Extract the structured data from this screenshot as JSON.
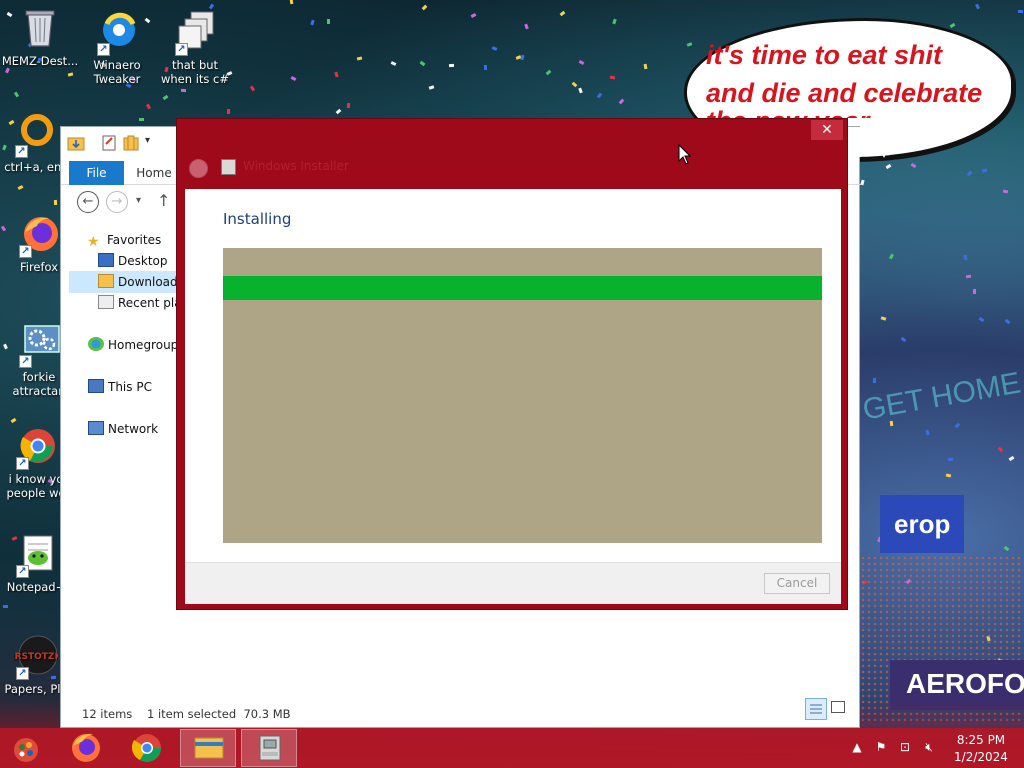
{
  "desktop": {
    "wallpaper_caption": [
      "it's time to eat shit",
      "and die and celebrate",
      "the new year"
    ],
    "icons": [
      {
        "label": "MEMZ-Dest...",
        "icon": "recycle-bin-icon"
      },
      {
        "label": "Winaero Tweaker",
        "icon": "winaero-tweaker-icon"
      },
      {
        "label": "that but when its c#",
        "icon": "windows-stack-icon"
      },
      {
        "label": "ctrl+a, ent",
        "icon": "orange-ring-icon"
      },
      {
        "label": "Firefox",
        "icon": "firefox-icon"
      },
      {
        "label": "forkie attractan",
        "icon": "settings-monitor-icon"
      },
      {
        "label": "i know yo people we",
        "icon": "chrome-icon"
      },
      {
        "label": "Notepad+",
        "icon": "notepad-plus-icon"
      },
      {
        "label": "Papers, Ple",
        "icon": "papers-please-icon"
      }
    ]
  },
  "explorer": {
    "ribbon_tabs": {
      "file": "File",
      "home": "Home"
    },
    "tree": {
      "favorites": "Favorites",
      "desktop": "Desktop",
      "downloads": "Downloads",
      "recent": "Recent plac",
      "homegroup": "Homegroup",
      "this_pc": "This PC",
      "network": "Network"
    },
    "status": {
      "items": "12 items",
      "selected": "1 item selected  70.3 MB"
    }
  },
  "installer": {
    "title": "Windows Installer",
    "heading": "Installing",
    "progress_fraction": 1.0,
    "cancel_label": "Cancel",
    "close_glyph": "✕",
    "colors": {
      "frame": "#9e0a1a",
      "progress_track": "#ada585",
      "progress_fill": "#08b22e"
    }
  },
  "taskbar": {
    "items": [
      {
        "name": "start",
        "icon": "start-orb-icon"
      },
      {
        "name": "firefox",
        "icon": "firefox-icon"
      },
      {
        "name": "chrome",
        "icon": "chrome-icon"
      },
      {
        "name": "file-explorer",
        "icon": "folder-icon",
        "active": true
      },
      {
        "name": "installer",
        "icon": "installer-icon",
        "active": true
      }
    ],
    "clock": {
      "time": "8:25 PM",
      "date": "1/2/2024"
    },
    "color": "#b21826"
  }
}
